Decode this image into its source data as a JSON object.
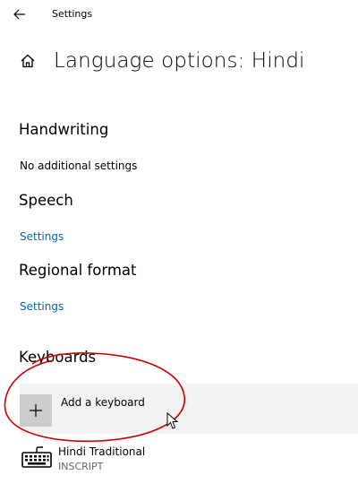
{
  "window": {
    "app_title": "Settings",
    "back_icon": "arrow-left-icon"
  },
  "header": {
    "home_icon": "home-icon",
    "title": "Language options: Hindi"
  },
  "handwriting": {
    "heading": "Handwriting",
    "text": "No additional settings"
  },
  "speech": {
    "heading": "Speech",
    "link": "Settings"
  },
  "regional_format": {
    "heading": "Regional format",
    "link": "Settings"
  },
  "keyboards": {
    "heading": "Keyboards",
    "add_label": "Add a keyboard",
    "add_icon": "plus-icon",
    "items": [
      {
        "name": "Hindi Traditional",
        "subtitle": "INSCRIPT",
        "icon": "keyboard-icon"
      }
    ]
  },
  "colors": {
    "link": "#0067b8",
    "row_highlight": "#f2f2f2",
    "plus_tile": "#cccccc",
    "annotation": "#cc0000"
  }
}
